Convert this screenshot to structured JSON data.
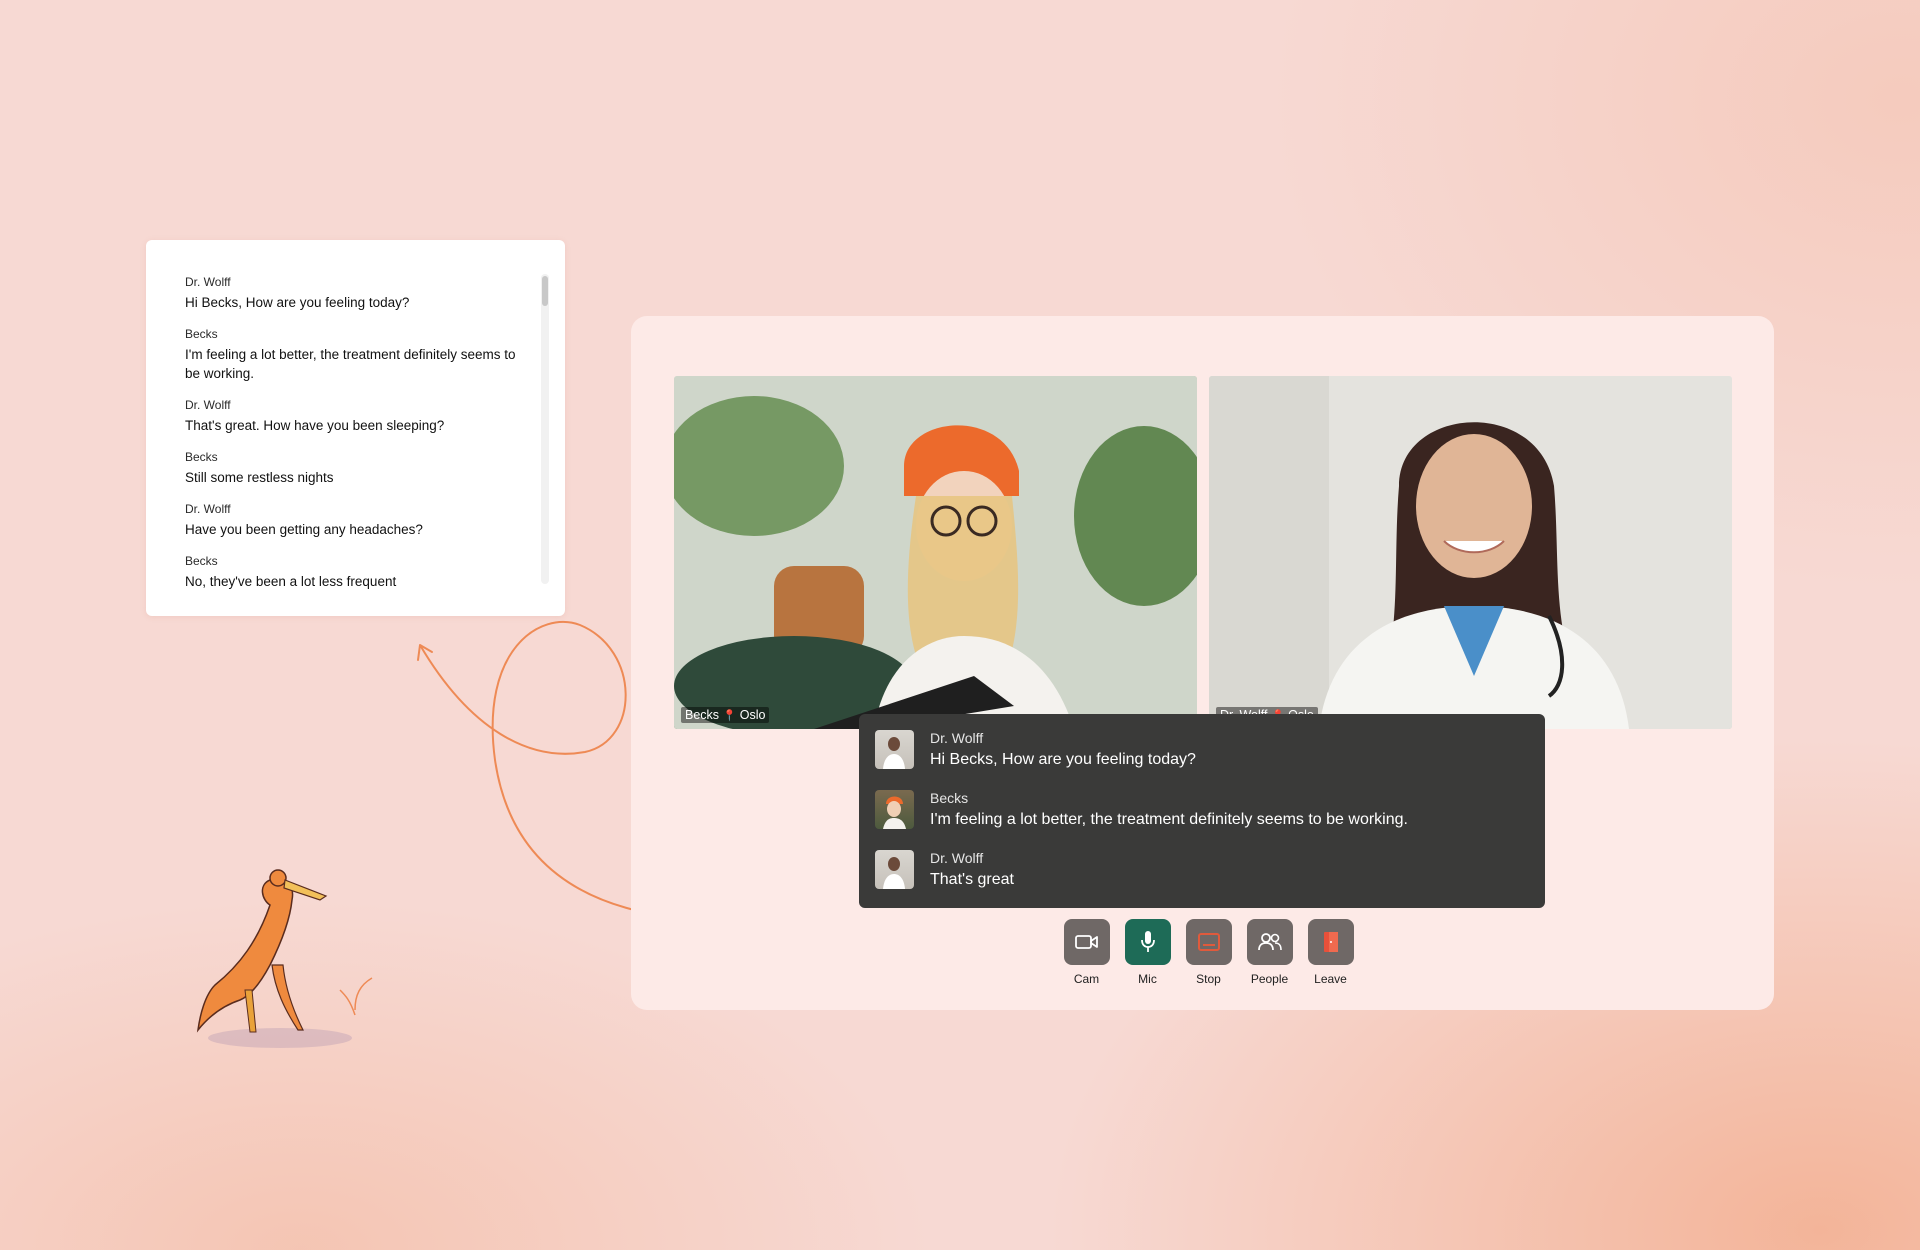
{
  "transcript": {
    "entries": [
      {
        "name": "Dr. Wolff",
        "text": "Hi Becks, How are you feeling today?"
      },
      {
        "name": "Becks",
        "text": "I'm feeling a lot better, the treatment definitely seems to be working."
      },
      {
        "name": "Dr. Wolff",
        "text": "That's great. How have you been sleeping?"
      },
      {
        "name": "Becks",
        "text": "Still some restless nights"
      },
      {
        "name": "Dr. Wolff",
        "text": "Have you been getting any headaches?"
      },
      {
        "name": "Becks",
        "text": "No, they've been a lot less frequent"
      }
    ]
  },
  "videos": {
    "patient": {
      "name": "Becks",
      "location": "Oslo"
    },
    "doctor": {
      "name": "Dr. Wolff",
      "location": "Oslo"
    }
  },
  "captions": [
    {
      "name": "Dr. Wolff",
      "text": "Hi Becks, How are you feeling today?",
      "avatar": "doctor"
    },
    {
      "name": "Becks",
      "text": "I'm feeling a lot better, the treatment definitely seems to be working.",
      "avatar": "patient"
    },
    {
      "name": "Dr. Wolff",
      "text": "That's great",
      "avatar": "doctor"
    }
  ],
  "controls": {
    "cam": {
      "label": "Cam",
      "icon": "camera-icon"
    },
    "mic": {
      "label": "Mic",
      "icon": "microphone-icon",
      "color": "#1e6b57"
    },
    "stop": {
      "label": "Stop",
      "icon": "caption-icon",
      "color": "#e05a3c"
    },
    "people": {
      "label": "People",
      "icon": "people-icon"
    },
    "leave": {
      "label": "Leave",
      "icon": "leave-door-icon",
      "color": "#e8503a"
    }
  },
  "colors": {
    "background": "#f7d9d3",
    "card": "#fdeae7",
    "accent": "#ee8a55"
  }
}
